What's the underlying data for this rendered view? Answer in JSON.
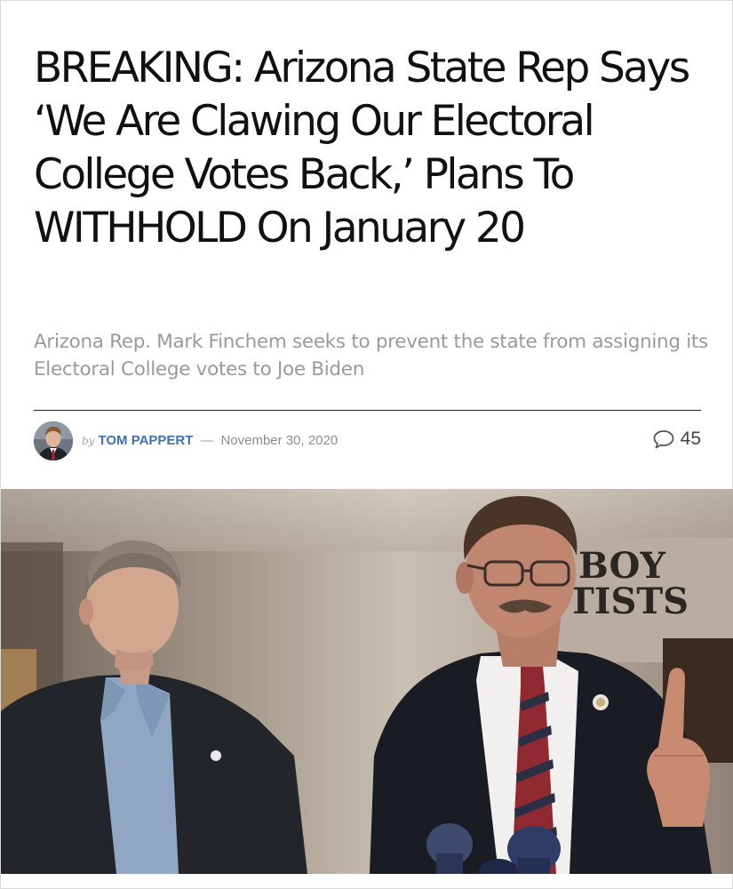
{
  "article": {
    "headline": "BREAKING: Arizona State Rep Says ‘We Are Clawing Our Electoral College Votes Back,’ Plans To WITHHOLD On January 20",
    "subtitle": "Arizona Rep. Mark Finchem seeks to prevent the state from assigning its Electoral College votes to Joe Biden",
    "byline": {
      "prefix": "by",
      "author": "TOM PAPPERT",
      "separator": "—",
      "date": "November 30, 2020"
    },
    "comments": {
      "count": "45",
      "icon": "comment-bubble-icon"
    },
    "featured_image": {
      "sign_text_line1": "BOY",
      "sign_text_line2": "TISTS"
    }
  },
  "colors": {
    "headline": "#111111",
    "subtitle": "#9a9a9a",
    "author_link": "#3f6fb5",
    "date": "#8e8e8e"
  }
}
